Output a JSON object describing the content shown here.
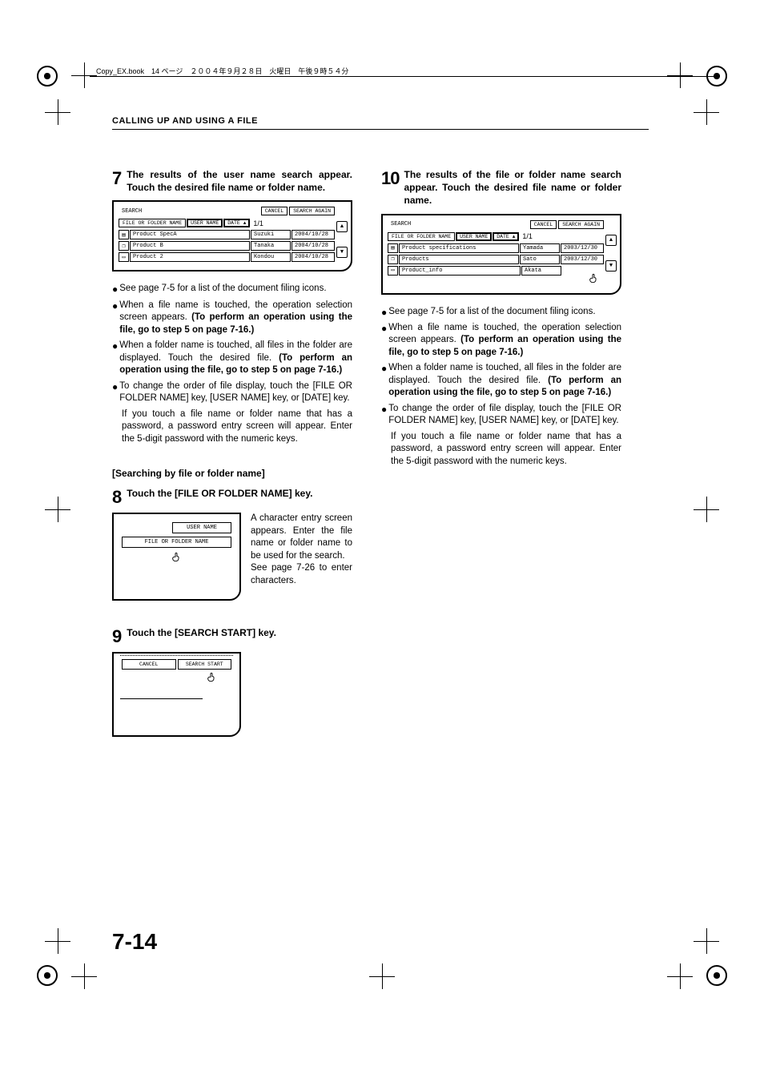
{
  "meta": {
    "top_info": "Copy_EX.book　14 ページ　２００４年９月２８日　火曜日　午後９時５４分"
  },
  "header": "CALLING UP AND USING A FILE",
  "page_number": "7-14",
  "step7": {
    "num": "7",
    "title": "The results of the user name search appear. Touch the desired file name or folder name.",
    "panel": {
      "title": "SEARCH",
      "cancel": "CANCEL",
      "again": "SEARCH AGAIN",
      "tab_file": "FILE OR FOLDER NAME",
      "tab_user": "USER NAME",
      "tab_date": "DATE",
      "page": "1/1",
      "rows": [
        {
          "icon": "doc",
          "name": "Product SpecA",
          "user": "Suzuki",
          "date": "2004/10/28"
        },
        {
          "icon": "copy",
          "name": "Product B",
          "user": "Tanaka",
          "date": "2004/10/28"
        },
        {
          "icon": "folder",
          "name": "Product 2",
          "user": "Kondou",
          "date": "2004/10/28"
        }
      ]
    }
  },
  "step10": {
    "num": "10",
    "title": "The results of the file or folder name search appear. Touch the desired file name or folder name.",
    "panel": {
      "title": "SEARCH",
      "cancel": "CANCEL",
      "again": "SEARCH AGAIN",
      "tab_file": "FILE OR FOLDER NAME",
      "tab_user": "USER NAME",
      "tab_date": "DATE",
      "page": "1/1",
      "rows": [
        {
          "icon": "doc",
          "name": "Product specifications",
          "user": "Yamada",
          "date": "2003/12/30"
        },
        {
          "icon": "copy",
          "name": "Products",
          "user": "Sato",
          "date": "2003/12/30"
        },
        {
          "icon": "folder",
          "name": "Product_info",
          "user": "Akata",
          "date": ""
        }
      ]
    }
  },
  "bullets": [
    {
      "text": "See page 7-5 for a list of the document filing icons."
    },
    {
      "text": "When a file name is touched, the operation selection screen appears. ",
      "bold": "(To perform an operation using the file, go to step 5 on page 7-16.)"
    },
    {
      "text": "When a folder name is touched, all files in the folder are displayed. Touch the desired file. ",
      "bold": "(To perform an operation using the file, go to step 5 on page 7-16.)"
    },
    {
      "text": "To change the order of file display, touch the [FILE OR FOLDER NAME] key, [USER NAME] key, or [DATE] key."
    }
  ],
  "after_bullets": "If you touch a file name or folder name that has a password, a password entry screen will appear. Enter the 5-digit password with the numeric keys.",
  "subhead": "[Searching by file or folder name]",
  "step8": {
    "num": "8",
    "title": "Touch the [FILE OR FOLDER NAME] key.",
    "panel": {
      "user": "USER NAME",
      "file": "FILE OR FOLDER NAME"
    },
    "text1": "A character entry screen appears. Enter the file name or folder name to be used for the search.",
    "text2": "See page 7-26 to enter characters."
  },
  "step9": {
    "num": "9",
    "title": "Touch the [SEARCH START] key.",
    "panel": {
      "cancel": "CANCEL",
      "start": "SEARCH START"
    }
  }
}
